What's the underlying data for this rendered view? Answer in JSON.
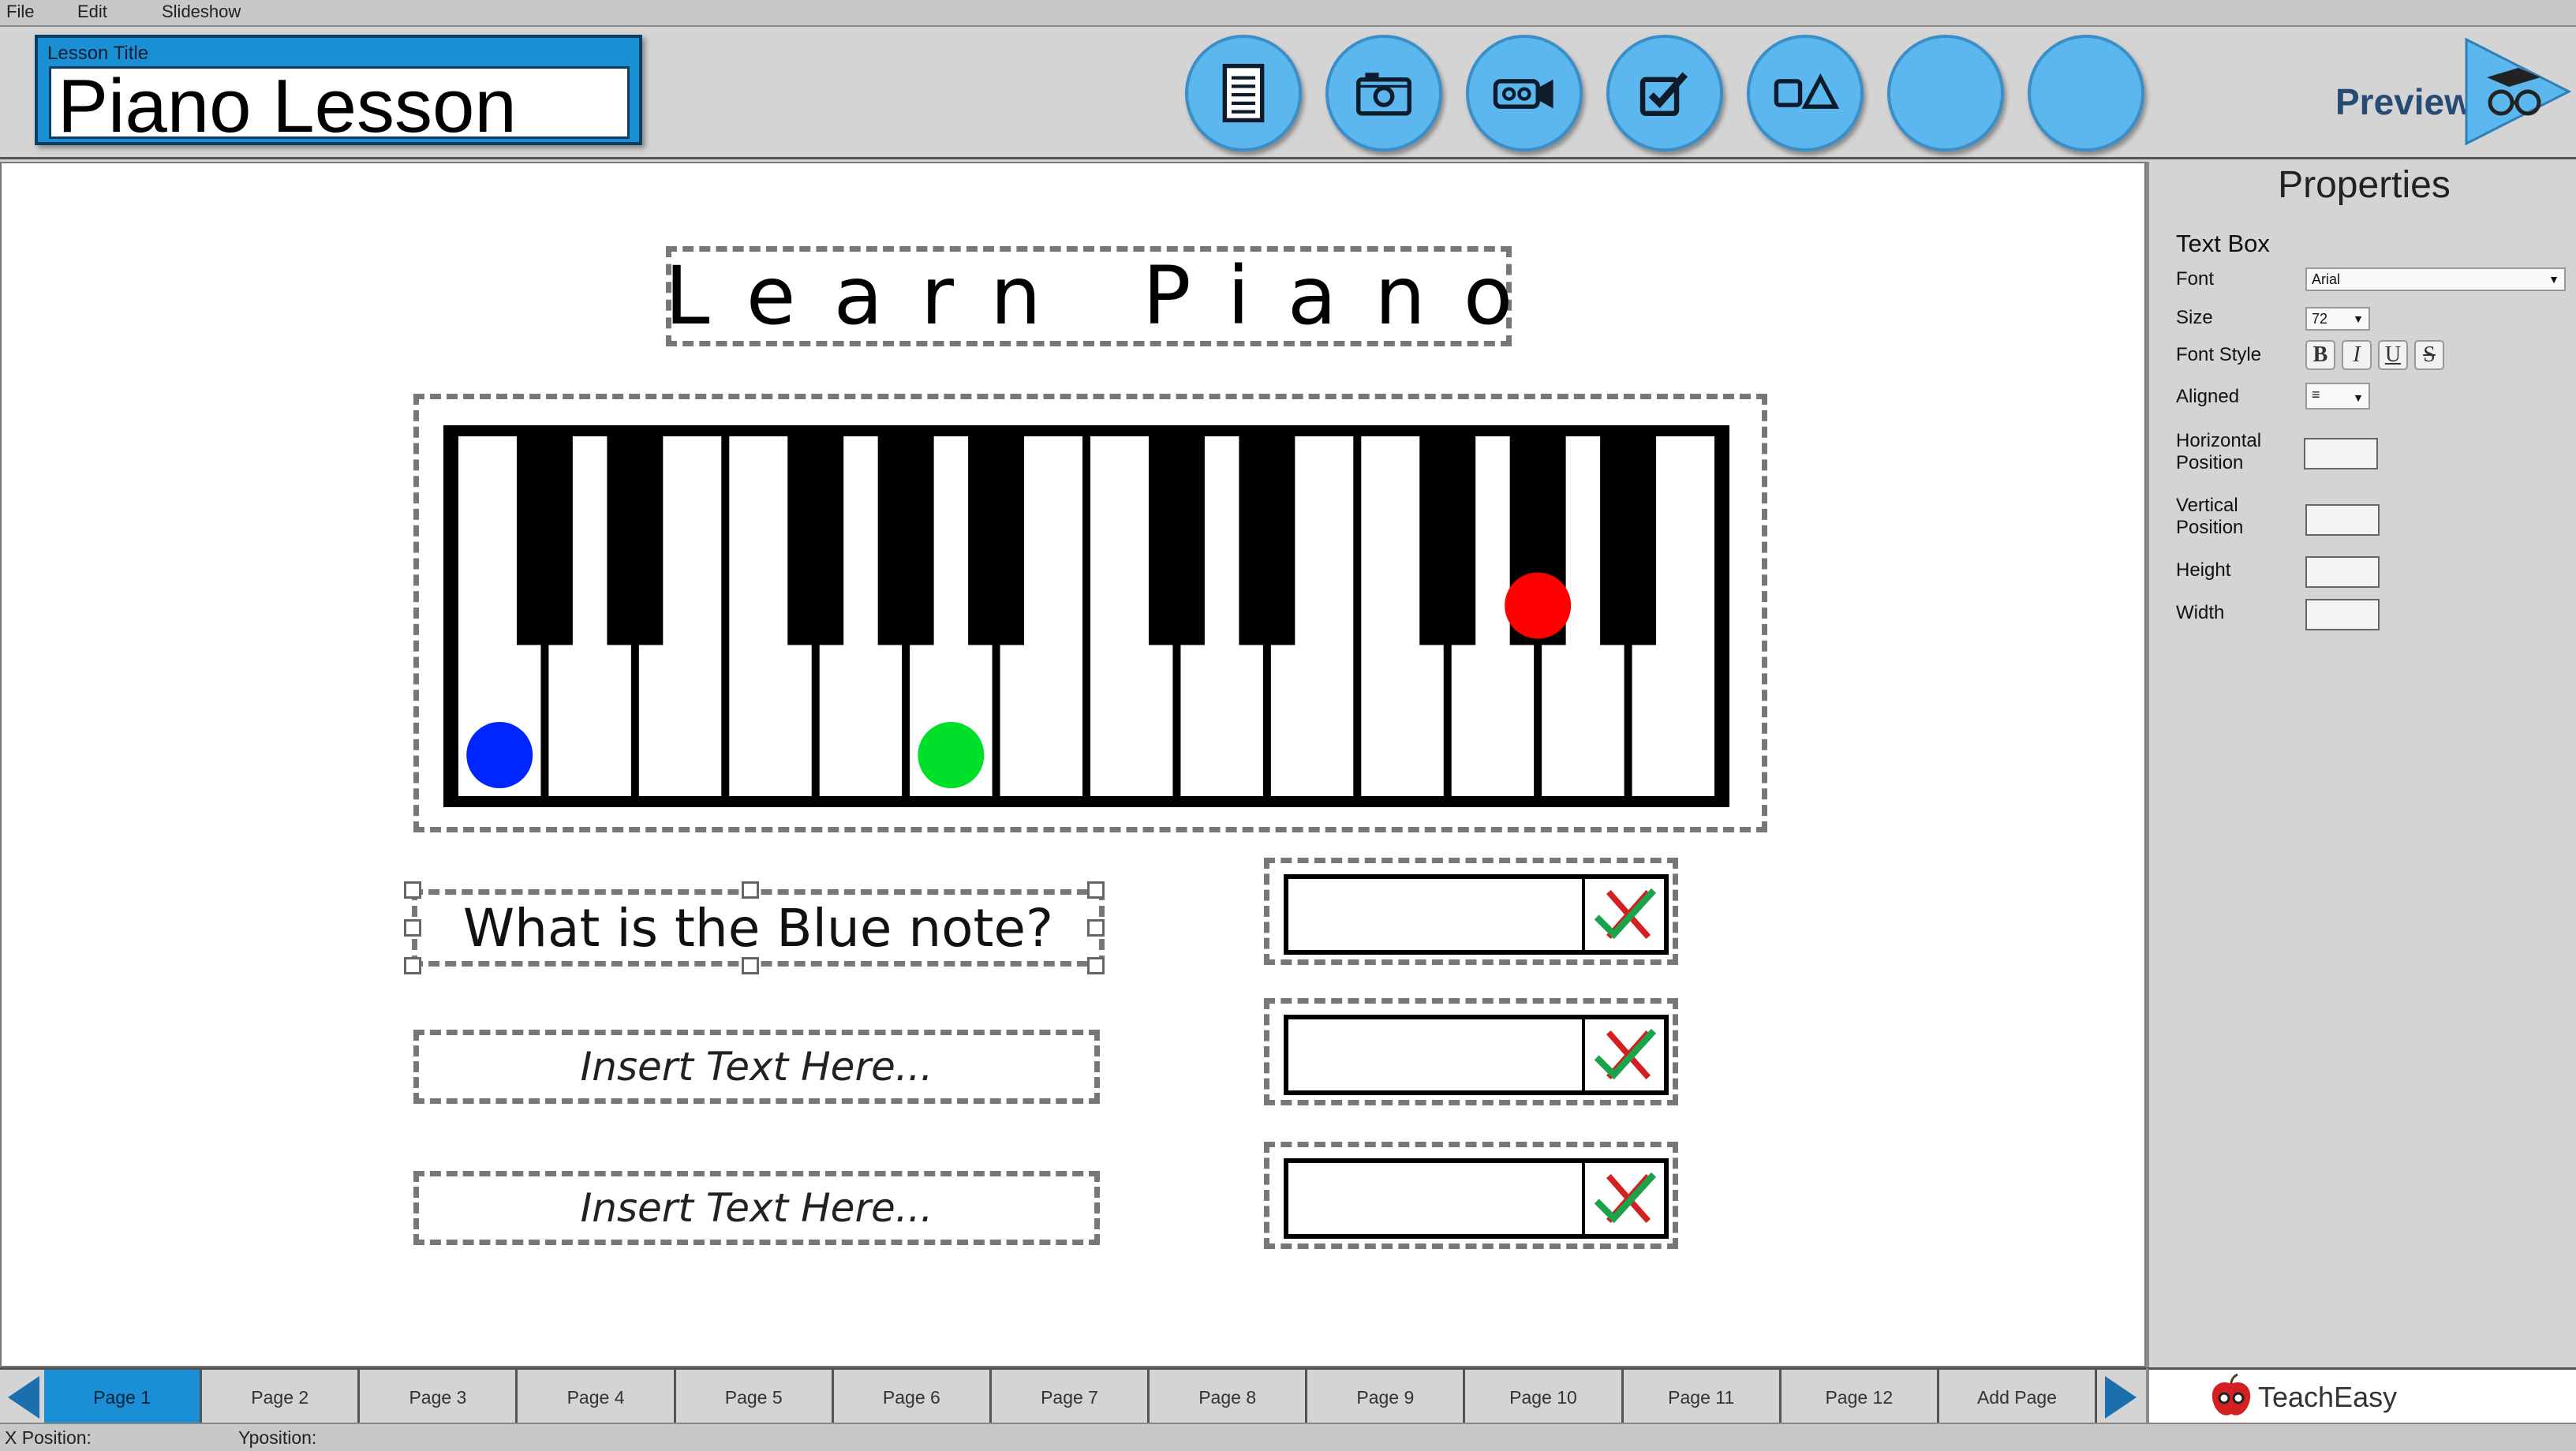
{
  "menu": {
    "items": [
      "File",
      "Edit",
      "Slideshow"
    ]
  },
  "lesson": {
    "label": "Lesson Title",
    "title": "Piano Lesson"
  },
  "toolbar": {
    "tools": [
      {
        "name": "text-tool",
        "icon": "document-icon"
      },
      {
        "name": "image-tool",
        "icon": "camera-icon"
      },
      {
        "name": "video-tool",
        "icon": "video-camera-icon"
      },
      {
        "name": "quiz-tool",
        "icon": "checkbox-icon"
      },
      {
        "name": "shapes-tool",
        "icon": "shapes-icon"
      },
      {
        "name": "blank-tool-1",
        "icon": ""
      },
      {
        "name": "blank-tool-2",
        "icon": ""
      }
    ],
    "preview_label": "Preview",
    "accent": "#5bb7ee"
  },
  "slide": {
    "heading": "Learn Piano",
    "question": "What is the Blue note?",
    "answer_placeholder_1": "Insert Text Here...",
    "answer_placeholder_2": "Insert Text Here...",
    "piano": {
      "white_keys": 14,
      "markers": [
        {
          "color": "#0026ff",
          "key": "white-1"
        },
        {
          "color": "#00e02a",
          "key": "white-6"
        },
        {
          "color": "#ff0000",
          "key": "black-9"
        }
      ]
    }
  },
  "properties": {
    "title": "Properties",
    "section": "Text Box",
    "font_label": "Font",
    "font_value": "Arial",
    "size_label": "Size",
    "size_value": "72",
    "style_label": "Font Style",
    "bold": "B",
    "italic": "I",
    "underline": "U",
    "strike": "S",
    "aligned_label": "Aligned",
    "horizontal_line1": "Horizontal",
    "horizontal_line2": "Position",
    "vertical_line1": "Vertical",
    "vertical_line2": "Position",
    "height_label": "Height",
    "width_label": "Width"
  },
  "pages": {
    "tabs": [
      "Page 1",
      "Page 2",
      "Page 3",
      "Page 4",
      "Page 5",
      "Page 6",
      "Page 7",
      "Page 8",
      "Page 9",
      "Page 10",
      "Page 11",
      "Page 12",
      "Add Page"
    ],
    "active_index": 0
  },
  "brand": {
    "name": "TeachEasy"
  },
  "status": {
    "x_label": "X Position:",
    "y_label": "Yposition:"
  }
}
